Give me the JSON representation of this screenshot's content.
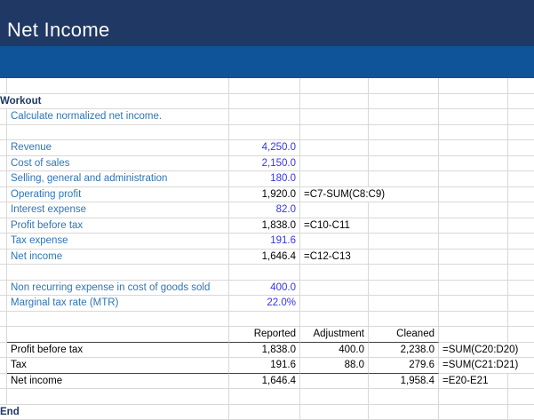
{
  "title": {
    "text": "Net Income"
  },
  "colors": {
    "band_top": "#1F3864",
    "band_bottom": "#0F5499",
    "gridline": "#D8D8D8",
    "dark_border": "#3F3F3F",
    "label_blue": "#2E75B6",
    "input_blue": "#3434E8",
    "heading_navy": "#1F3864"
  },
  "sheet": {
    "rows": [
      {
        "type": "empty"
      },
      {
        "type": "heading",
        "label": "Workout"
      },
      {
        "type": "label",
        "label": "Calculate normalized net income."
      },
      {
        "type": "empty"
      },
      {
        "type": "input",
        "label": "Revenue",
        "value": "4,250.0"
      },
      {
        "type": "input",
        "label": "Cost of sales",
        "value": "2,150.0"
      },
      {
        "type": "input",
        "label": "Selling, general and administration",
        "value": "180.0"
      },
      {
        "type": "calc",
        "label": "Operating profit",
        "value": "1,920.0",
        "formula": "=C7-SUM(C8:C9)",
        "formula_span": 2
      },
      {
        "type": "input",
        "label": "Interest expense",
        "value": "82.0"
      },
      {
        "type": "calc",
        "label": "Profit before tax",
        "value": "1,838.0",
        "formula": "=C10-C11",
        "formula_span": 1
      },
      {
        "type": "input",
        "label": "Tax expense",
        "value": "191.6"
      },
      {
        "type": "calc",
        "label": "Net income",
        "value": "1,646.4",
        "formula": "=C12-C13",
        "formula_span": 1
      },
      {
        "type": "empty"
      },
      {
        "type": "input",
        "label": "Non recurring expense in cost of goods sold",
        "value": "400.0"
      },
      {
        "type": "input",
        "label": "Marginal tax rate (MTR)",
        "value": "22.0%"
      },
      {
        "type": "empty"
      },
      {
        "type": "table_header",
        "c": "Reported",
        "d": "Adjustment",
        "e": "Cleaned",
        "dark_bottom": true
      },
      {
        "type": "table_row",
        "label": "Profit before tax",
        "c": "1,838.0",
        "d": "400.0",
        "e": "2,238.0",
        "formula": "=SUM(C20:D20)",
        "formula_span": 2
      },
      {
        "type": "table_row",
        "label": "Tax",
        "c": "191.6",
        "d": "88.0",
        "e": "279.6",
        "formula": "=SUM(C21:D21)",
        "formula_span": 2,
        "dark_bottom": true
      },
      {
        "type": "table_row",
        "label": "Net income",
        "c": "1,646.4",
        "d": "",
        "e": "1,958.4",
        "formula": "=E20-E21",
        "formula_span": 1
      },
      {
        "type": "empty"
      },
      {
        "type": "heading",
        "label": "End"
      }
    ]
  }
}
